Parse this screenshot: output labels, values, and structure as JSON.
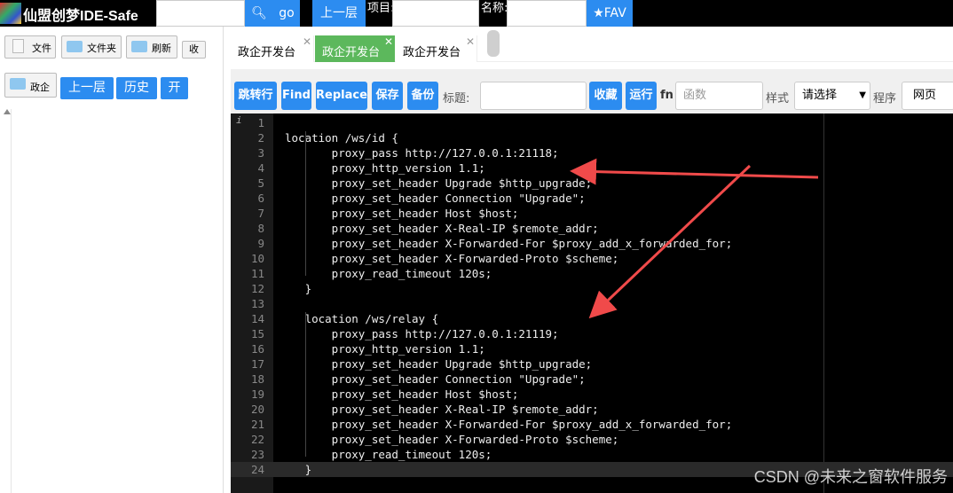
{
  "header": {
    "app_title": "仙盟创梦IDE-Safe",
    "go_label": "go",
    "up_label": "上一层",
    "project_label": "项目:",
    "name_label": "名称:",
    "fav_label": "★FAV"
  },
  "sidebar": {
    "file_label": "文件",
    "folder_label": "文件夹",
    "refresh_label": "刷新",
    "collapse_label": "收",
    "current_folder": "政企",
    "up_label": "上一层",
    "history_label": "历史",
    "open_label": "开"
  },
  "tabs": [
    {
      "label": "政企开发台"
    },
    {
      "label": "政企开发台"
    },
    {
      "label": "政企开发台"
    }
  ],
  "toolbar": {
    "goto_label": "跳转行",
    "find_label": "Find",
    "replace_label": "Replace",
    "save_label": "保存",
    "backup_label": "备份",
    "title_label": "标题:",
    "favorite_label": "收藏",
    "run_label": "运行",
    "fn_label": "fn",
    "func_placeholder": "函数",
    "style_label": "样式",
    "style_value": "请选择",
    "program_label": "程序",
    "program_value": "网页"
  },
  "editor": {
    "lines": [
      "",
      "location /ws/id {",
      "       proxy_pass http://127.0.0.1:21118;",
      "       proxy_http_version 1.1;",
      "       proxy_set_header Upgrade $http_upgrade;",
      "       proxy_set_header Connection \"Upgrade\";",
      "       proxy_set_header Host $host;",
      "       proxy_set_header X-Real-IP $remote_addr;",
      "       proxy_set_header X-Forwarded-For $proxy_add_x_forwarded_for;",
      "       proxy_set_header X-Forwarded-Proto $scheme;",
      "       proxy_read_timeout 120s;",
      "   }",
      "",
      "   location /ws/relay {",
      "       proxy_pass http://127.0.0.1:21119;",
      "       proxy_http_version 1.1;",
      "       proxy_set_header Upgrade $http_upgrade;",
      "       proxy_set_header Connection \"Upgrade\";",
      "       proxy_set_header Host $host;",
      "       proxy_set_header X-Real-IP $remote_addr;",
      "       proxy_set_header X-Forwarded-For $proxy_add_x_forwarded_for;",
      "       proxy_set_header X-Forwarded-Proto $scheme;",
      "       proxy_read_timeout 120s;",
      "   }"
    ],
    "current_line": 24,
    "info_icon": "i"
  },
  "watermark": "CSDN @未来之窗软件服务",
  "colors": {
    "accent": "#2c8cf0",
    "active_tab": "#5cb85c",
    "arrow": "#f04a4a"
  }
}
